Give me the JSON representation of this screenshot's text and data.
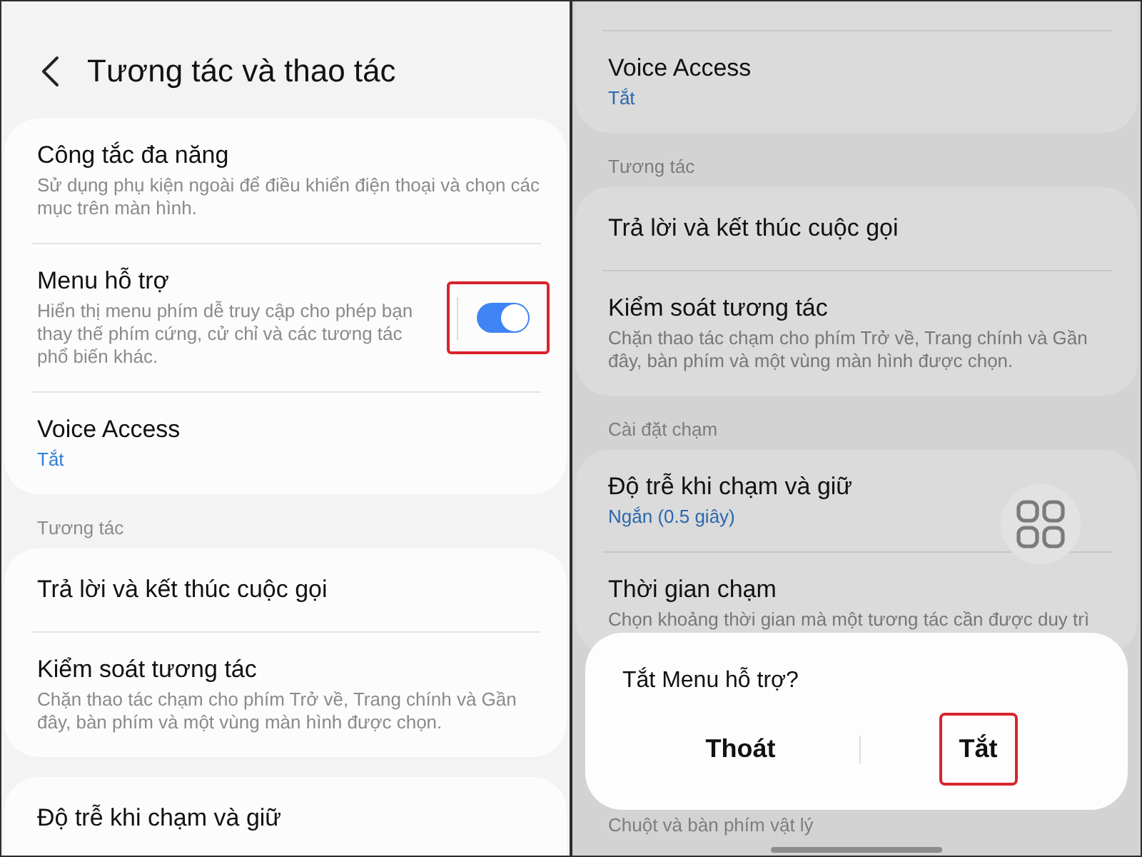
{
  "screens": [
    {
      "dimmed": false,
      "header": {
        "title": "Tương tác và thao tác"
      },
      "groups": [
        {
          "items": [
            {
              "kind": "text",
              "title": "Công tắc đa năng",
              "summary": "Sử dụng phụ kiện ngoài để điều khiển điện thoại và chọn các mục trên màn hình."
            },
            {
              "kind": "switch",
              "title": "Menu hỗ trợ",
              "summary": "Hiển thị menu phím dễ truy cập cho phép bạn thay thế phím cứng, cử chỉ và các tương tác phổ biến khác.",
              "on": true,
              "highlighted": true
            },
            {
              "kind": "text",
              "title": "Voice Access",
              "value": "Tắt"
            }
          ]
        },
        {
          "label": "Tương tác",
          "items": [
            {
              "kind": "text",
              "title": "Trả lời và kết thúc cuộc gọi"
            },
            {
              "kind": "text",
              "title": "Kiểm soát tương tác",
              "summary": "Chặn thao tác chạm cho phím Trở về, Trang chính và Gần đây, bàn phím và một vùng màn hình được chọn."
            }
          ]
        },
        {
          "cut_off_below": true,
          "items": [
            {
              "kind": "text",
              "title": "Độ trễ khi chạm và giữ"
            }
          ]
        }
      ]
    },
    {
      "dimmed": true,
      "floating_button": true,
      "gesture_bar": true,
      "groups": [
        {
          "cut_off_above": true,
          "items": [
            {
              "kind": "text",
              "title": "Voice Access",
              "value": "Tắt"
            }
          ]
        },
        {
          "label": "Tương tác",
          "items": [
            {
              "kind": "text",
              "title": "Trả lời và kết thúc cuộc gọi"
            },
            {
              "kind": "text",
              "title": "Kiểm soát tương tác",
              "summary": "Chặn thao tác chạm cho phím Trở về, Trang chính và Gần đây, bàn phím và một vùng màn hình được chọn."
            }
          ]
        },
        {
          "label": "Cài đặt chạm",
          "items": [
            {
              "kind": "text",
              "title": "Độ trễ khi chạm và giữ",
              "value": "Ngắn (0.5 giây)"
            },
            {
              "kind": "text",
              "title": "Thời gian chạm",
              "summary": "Chọn khoảng thời gian mà một tương tác cần được duy trì"
            }
          ]
        },
        {
          "label": "Chuột và bàn phím vật lý"
        }
      ],
      "dialog": {
        "title": "Tắt Menu hỗ trợ?",
        "buttons": [
          {
            "label": "Thoát",
            "highlighted": false
          },
          {
            "label": "Tắt",
            "highlighted": true
          }
        ]
      }
    }
  ]
}
